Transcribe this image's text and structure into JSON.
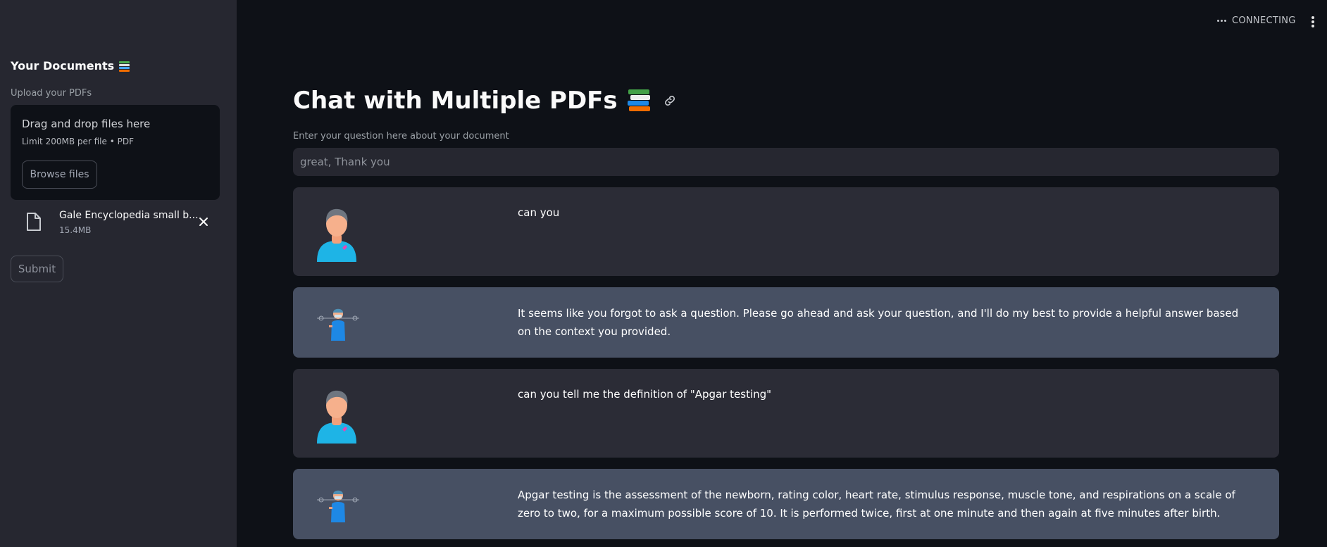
{
  "sidebar": {
    "title": "Your Documents",
    "upload_label": "Upload your PDFs",
    "dropzone": {
      "title": "Drag and drop files here",
      "limit": "Limit 200MB per file • PDF",
      "browse_label": "Browse files"
    },
    "file": {
      "name": "Gale Encyclopedia small b...",
      "size": "15.4MB"
    },
    "submit_label": "Submit"
  },
  "header": {
    "status": "CONNECTING"
  },
  "main": {
    "title": "Chat with Multiple PDFs",
    "question_label": "Enter your question here about your document",
    "question_placeholder": "great, Thank you",
    "messages": [
      {
        "role": "user",
        "text": "can you"
      },
      {
        "role": "bot",
        "text": "It seems like you forgot to ask a question. Please go ahead and ask your question, and I'll do my best to provide a helpful answer based on the context you provided."
      },
      {
        "role": "user",
        "text": "can you tell me the definition of \"Apgar testing\""
      },
      {
        "role": "bot",
        "text": "Apgar testing is the assessment of the newborn, rating color, heart rate, stimulus response, muscle tone, and respirations on a scale of zero to two, for a maximum possible score of 10. It is performed twice, first at one minute and then again at five minutes after birth."
      }
    ]
  },
  "colors": {
    "app_bg": "#0e1117",
    "sidebar_bg": "#262730",
    "user_msg_bg": "#2b2c36",
    "bot_msg_bg": "#475063"
  },
  "icons": {
    "title_emoji": "books-icon",
    "link": "link-icon",
    "file": "file-icon",
    "remove": "close-icon",
    "status": "more-horizontal-icon",
    "menu": "kebab-menu-icon"
  }
}
